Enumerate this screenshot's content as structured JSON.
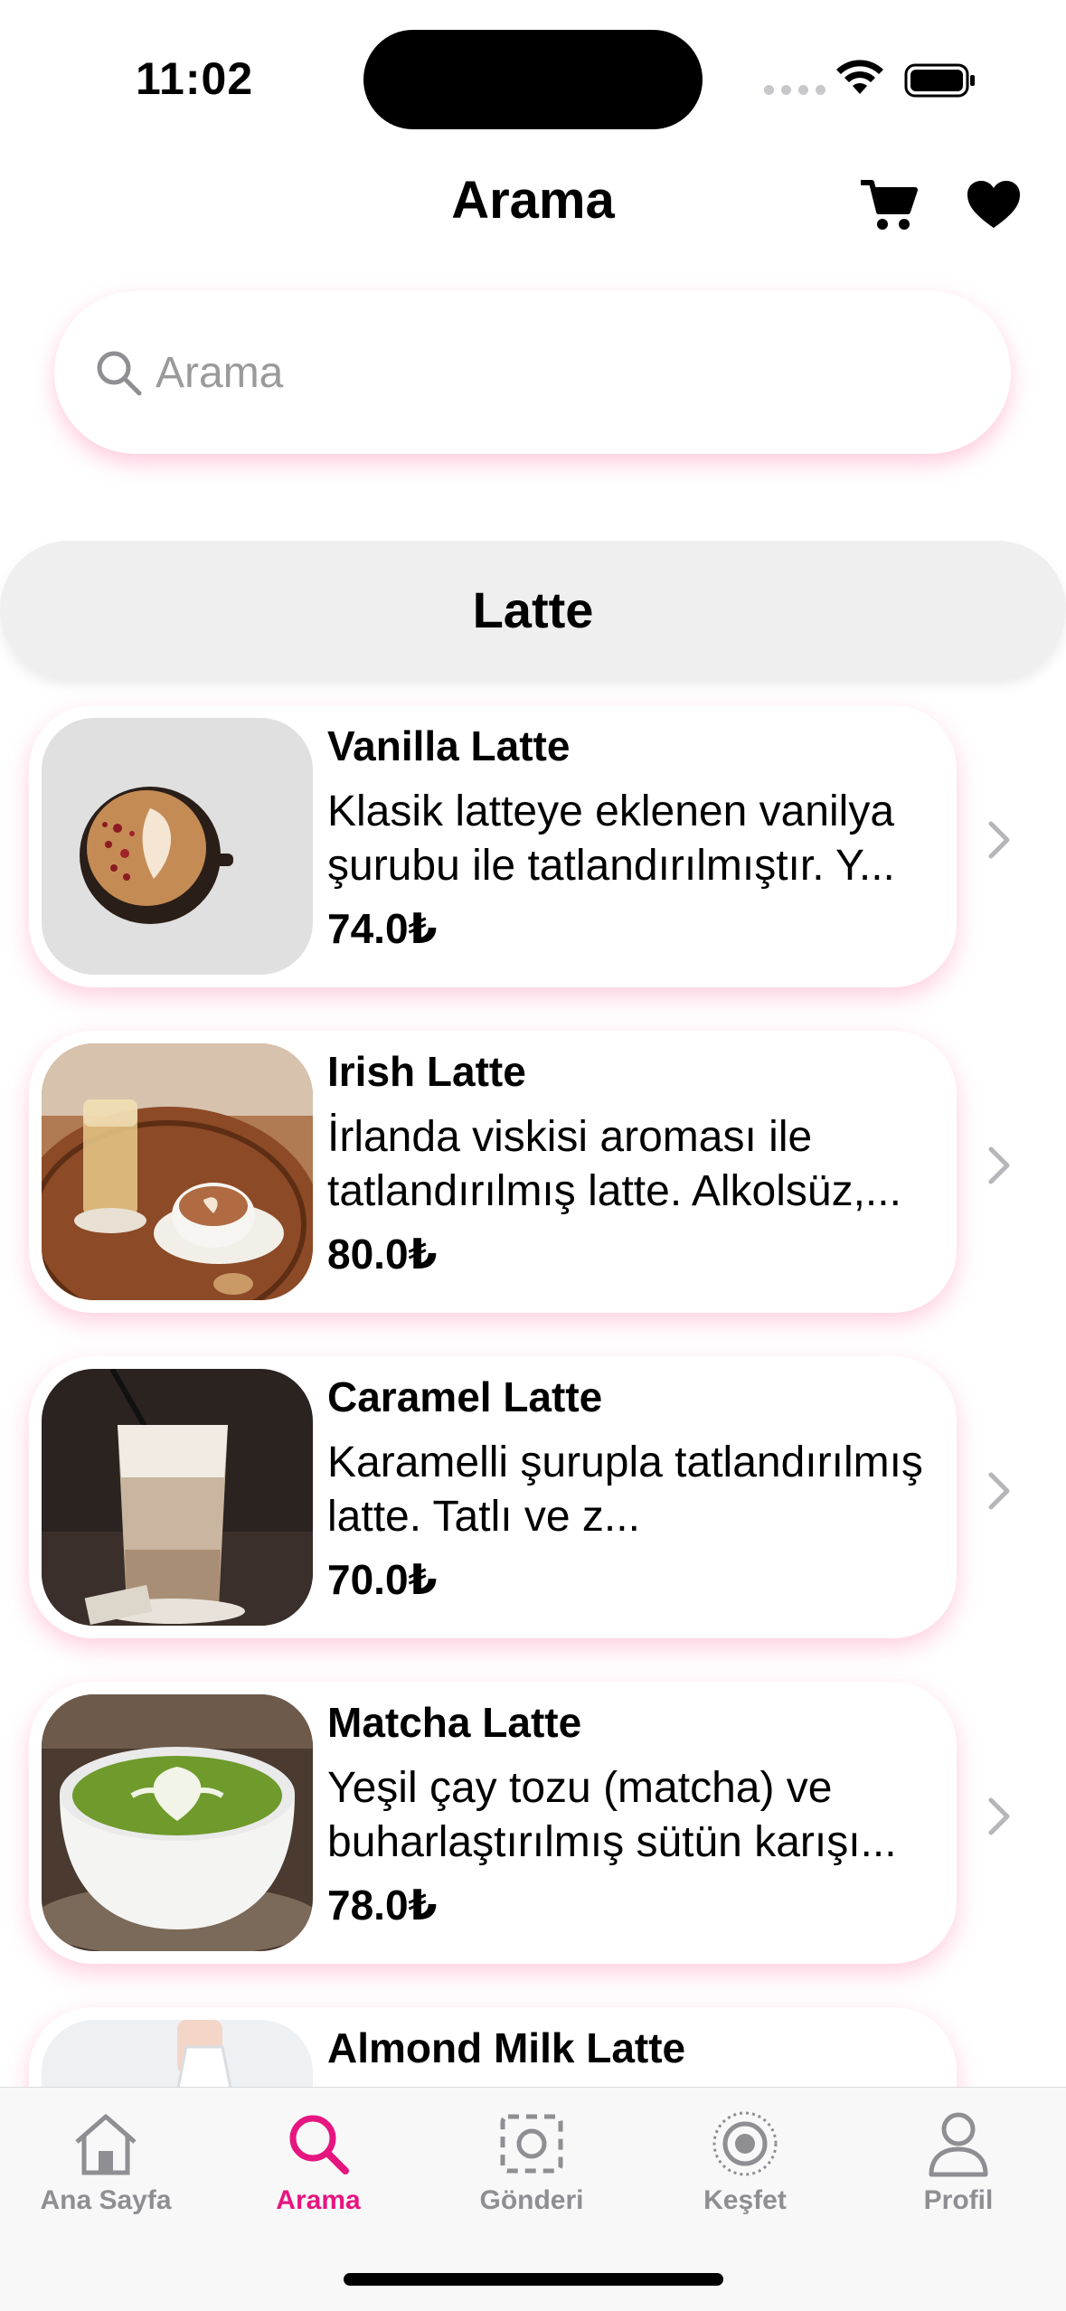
{
  "status_bar": {
    "time": "11:02"
  },
  "nav": {
    "title": "Arama"
  },
  "search": {
    "placeholder": "Arama"
  },
  "category": {
    "label": "Latte"
  },
  "items": [
    {
      "name": "Vanilla Latte",
      "description": "Klasik latteye eklenen vanilya şurubu ile tatlandırılmıştır. Y...",
      "price": "74.0₺"
    },
    {
      "name": "Irish Latte",
      "description": "İrlanda viskisi aroması ile tatlandırılmış latte. Alkolsüz,...",
      "price": "80.0₺"
    },
    {
      "name": "Caramel Latte",
      "description": "Karamelli şurupla tatlandırılmış latte. Tatlı ve z...",
      "price": "70.0₺"
    },
    {
      "name": "Matcha Latte",
      "description": "Yeşil çay tozu (matcha) ve buharlaştırılmış sütün karışı...",
      "price": "78.0₺"
    },
    {
      "name": "Almond Milk Latte",
      "description": "",
      "price": ""
    }
  ],
  "tabs": [
    {
      "label": "Ana Sayfa",
      "icon": "home-icon"
    },
    {
      "label": "Arama",
      "icon": "search-icon",
      "active": true
    },
    {
      "label": "Gönderi",
      "icon": "post-icon"
    },
    {
      "label": "Keşfet",
      "icon": "explore-icon"
    },
    {
      "label": "Profil",
      "icon": "profile-icon"
    }
  ],
  "colors": {
    "accent": "#e6157f",
    "shadow_pink": "#ff69a0",
    "chip_bg": "#efefef",
    "inactive": "#8e8e93"
  }
}
